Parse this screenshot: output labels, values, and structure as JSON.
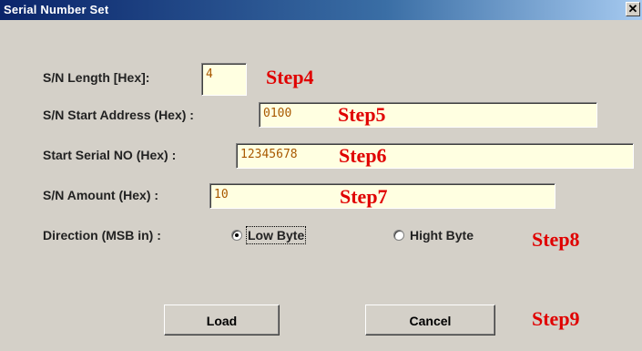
{
  "window": {
    "title": "Serial Number Set",
    "close_glyph": "✕"
  },
  "fields": {
    "length": {
      "label": "S/N Length [Hex]:",
      "value": "4",
      "step": "Step4"
    },
    "start_address": {
      "label": "S/N Start Address (Hex) :",
      "value": "0100",
      "step": "Step5"
    },
    "start_serial": {
      "label": "Start Serial NO (Hex) :",
      "value": "12345678",
      "step": "Step6"
    },
    "amount": {
      "label": "S/N Amount (Hex) :",
      "value": "10",
      "step": "Step7"
    }
  },
  "direction": {
    "label": "Direction (MSB in) :",
    "options": [
      {
        "label": "Low Byte",
        "checked": true
      },
      {
        "label": "Hight Byte",
        "checked": false
      }
    ],
    "step": "Step8"
  },
  "buttons": {
    "load": "Load",
    "cancel": "Cancel",
    "step": "Step9"
  },
  "colors": {
    "field_bg": "#ffffe1",
    "value_text": "#a85800",
    "step_text": "#e00000",
    "titlebar": "#0a246a"
  }
}
